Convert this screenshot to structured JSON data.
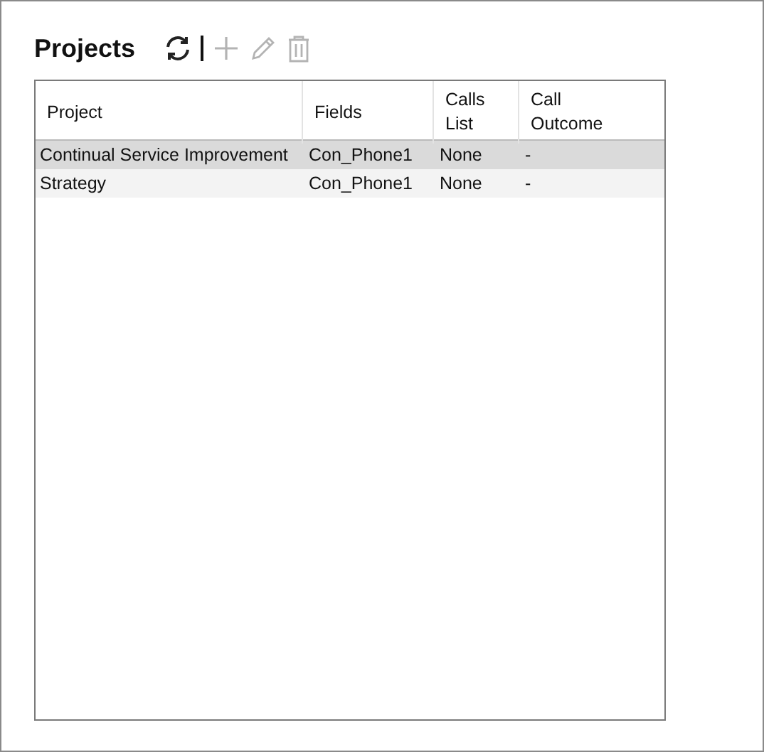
{
  "title": "Projects",
  "toolbar": [
    {
      "kind": "refresh",
      "disabled": false
    },
    {
      "kind": "separator"
    },
    {
      "kind": "add",
      "disabled": true
    },
    {
      "kind": "edit",
      "disabled": true
    },
    {
      "kind": "delete",
      "disabled": true
    }
  ],
  "table": {
    "columns": [
      "Project",
      "Fields",
      "Calls\nList",
      "Call\nOutcome"
    ],
    "rows": [
      {
        "cells": [
          "Continual Service Improvement",
          "Con_Phone1",
          "None",
          "-"
        ],
        "selected": true
      },
      {
        "cells": [
          "Strategy",
          "Con_Phone1",
          "None",
          "-"
        ],
        "selected": false
      }
    ]
  }
}
